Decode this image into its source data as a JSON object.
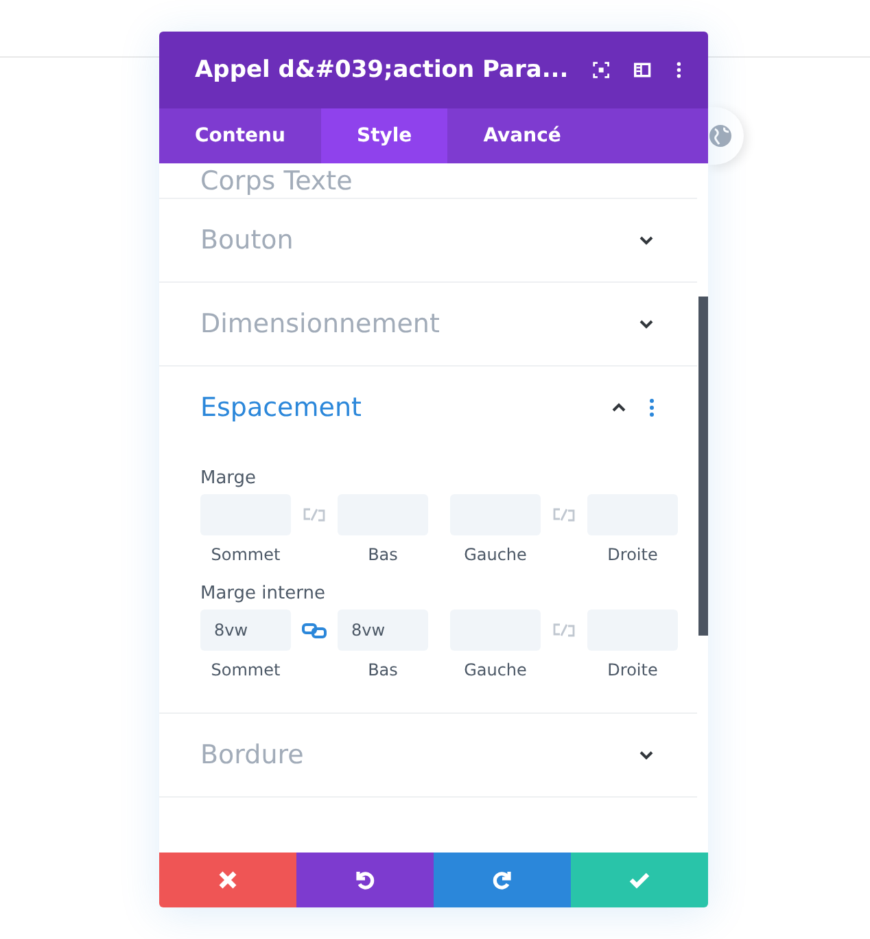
{
  "panel": {
    "title": "Appel d&#039;action Para..."
  },
  "tabs": [
    {
      "label": "Contenu",
      "selected": false
    },
    {
      "label": "Style",
      "selected": true
    },
    {
      "label": "Avancé",
      "selected": false
    }
  ],
  "sections": [
    {
      "title": "Corps Texte",
      "expanded": false,
      "kind": "partial"
    },
    {
      "title": "Bouton",
      "expanded": false,
      "kind": "toggle"
    },
    {
      "title": "Dimensionnement",
      "expanded": false,
      "kind": "toggle"
    },
    {
      "title": "Espacement",
      "expanded": true,
      "kind": "toggle",
      "groups": [
        {
          "label": "Marge",
          "pairs": [
            {
              "linked": false,
              "fields": [
                {
                  "label": "Sommet"
                },
                {
                  "label": "Bas"
                }
              ]
            },
            {
              "linked": false,
              "fields": [
                {
                  "label": "Gauche"
                },
                {
                  "label": "Droite"
                }
              ]
            }
          ]
        },
        {
          "label": "Marge interne",
          "pairs": [
            {
              "linked": true,
              "fields": [
                {
                  "label": "Sommet",
                  "value": "8vw"
                },
                {
                  "label": "Bas",
                  "value": "8vw"
                }
              ]
            },
            {
              "linked": false,
              "fields": [
                {
                  "label": "Gauche"
                },
                {
                  "label": "Droite"
                }
              ]
            }
          ]
        }
      ]
    },
    {
      "title": "Bordure",
      "expanded": false,
      "kind": "toggle"
    }
  ],
  "actions": [
    {
      "kind": "cancel"
    },
    {
      "kind": "undo"
    },
    {
      "kind": "redo"
    },
    {
      "kind": "save"
    }
  ]
}
